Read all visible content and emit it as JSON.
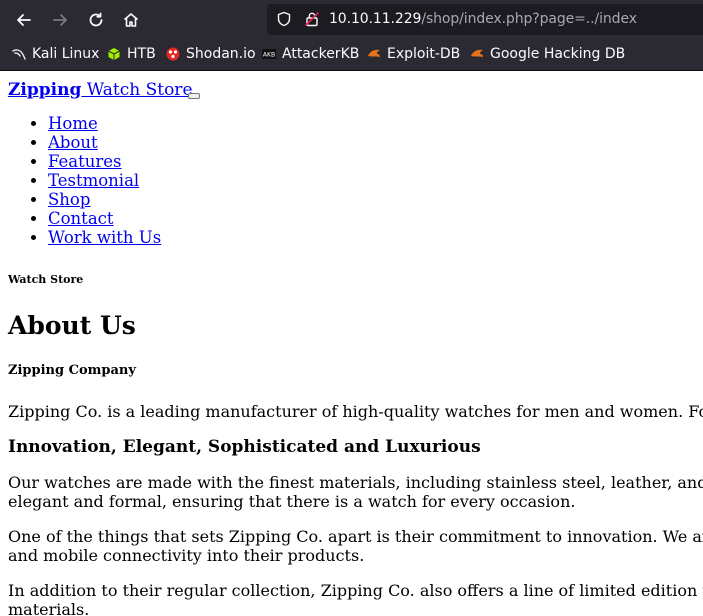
{
  "browser": {
    "url_host": "10.10.11.229",
    "url_path": "/shop/index.php?page=../index",
    "bookmarks": [
      "Kali Linux",
      "HTB",
      "Shodan.io",
      "AttackerKB",
      "Exploit-DB",
      "Google Hacking DB"
    ],
    "colors": {
      "chrome": "#2b2a33",
      "urlbar": "#1c1b22",
      "link": "#0000ee"
    }
  },
  "page": {
    "brand_bold": "Zipping",
    "brand_rest": " Watch Store",
    "nav": [
      "Home",
      "About",
      "Features",
      "Testmonial",
      "Shop",
      "Contact",
      "Work with Us"
    ],
    "kicker": "Watch Store",
    "title": "About Us",
    "company": "Zipping Company",
    "paragraph1": "Zipping Co. is a leading manufacturer of high-quality watches for men and women. Fo",
    "subtitle": "Innovation, Elegant, Sophisticated and Luxurious",
    "paragraph2_line1": "Our watches are made with the finest materials, including stainless steel, leather, and",
    "paragraph2_line2": "elegant and formal, ensuring that there is a watch for every occasion.",
    "paragraph3_line1": "One of the things that sets Zipping Co. apart is their commitment to innovation. We ar",
    "paragraph3_line2": "and mobile connectivity into their products.",
    "paragraph4_line1": "In addition to their regular collection, Zipping Co. also offers a line of limited edition w",
    "paragraph4_line2": "materials."
  }
}
